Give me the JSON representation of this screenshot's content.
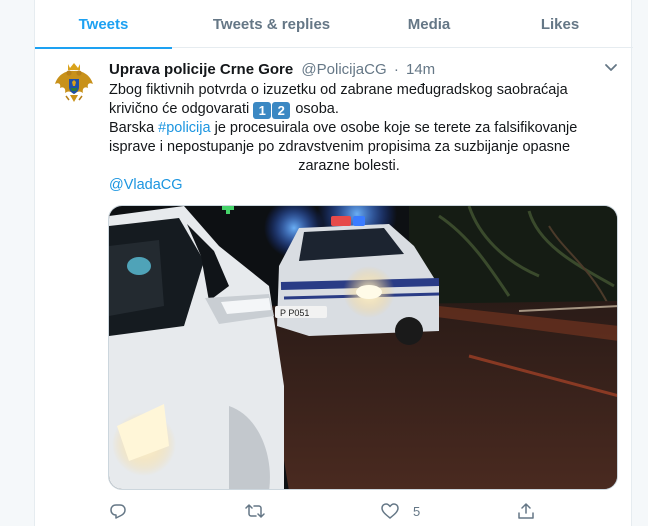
{
  "tabs": [
    {
      "label": "Tweets",
      "active": true
    },
    {
      "label": "Tweets & replies",
      "active": false
    },
    {
      "label": "Media",
      "active": false
    },
    {
      "label": "Likes",
      "active": false
    }
  ],
  "tweet": {
    "author_name": "Uprava policije Crne Gore",
    "handle": "@PolicijaCG",
    "separator": "·",
    "time": "14m",
    "line1": "Zbog fiktivnih potvrda o izuzetku od zabrane međugradskog saobraćaja",
    "line2_pre": "krivično će odgovarati",
    "keycap_1": "1",
    "keycap_2": "2",
    "line2_post": "osoba.",
    "line3_pre": "Barska",
    "hashtag": "#policija",
    "line3_post": "je procesuirala ove osobe koje se terete za falsifikovanje",
    "line4": "isprave i nepostupanje po zdravstvenim propisima za suzbijanje opasne",
    "line5": "zarazne bolesti.",
    "mention": "@VladaCG",
    "plate_text": "P P051",
    "like_count": "5"
  },
  "colors": {
    "accent": "#1da1f2",
    "link": "#1b95e0",
    "muted": "#657786",
    "keycap": "#3b88c3"
  },
  "icons": {
    "caret": "chevron-down-icon",
    "reply": "reply-icon",
    "retweet": "retweet-icon",
    "like": "heart-icon",
    "share": "share-icon",
    "avatar": "coat-of-arms-avatar"
  }
}
